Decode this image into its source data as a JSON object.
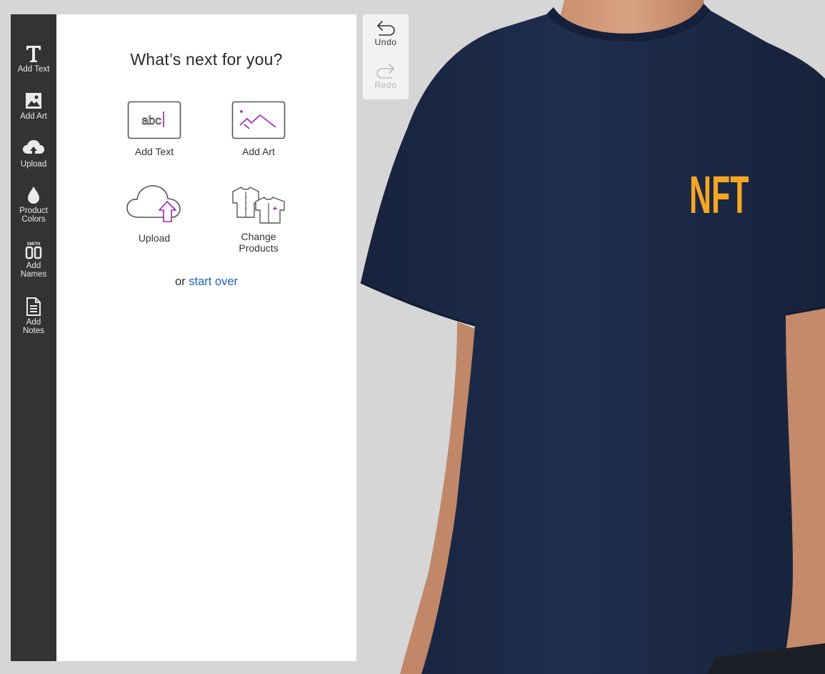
{
  "sidebar": {
    "items": [
      {
        "label": "Add Text",
        "icon": "text-icon"
      },
      {
        "label": "Add Art",
        "icon": "image-icon"
      },
      {
        "label": "Upload",
        "icon": "cloud-upload-icon"
      },
      {
        "label_line1": "Product",
        "label_line2": "Colors",
        "icon": "droplet-icon"
      },
      {
        "label_line1": "Add",
        "label_line2": "Names",
        "icon": "names-icon",
        "icon_text_top": "SMITH",
        "icon_text_bottom": "00"
      },
      {
        "label_line1": "Add",
        "label_line2": "Notes",
        "icon": "notes-icon"
      }
    ]
  },
  "panel": {
    "title": "What’s next for you?",
    "options": [
      {
        "label": "Add Text",
        "icon": "text-box-icon",
        "sample": "abc"
      },
      {
        "label": "Add Art",
        "icon": "art-frame-icon"
      },
      {
        "label": "Upload",
        "icon": "cloud-upload-arrow-icon"
      },
      {
        "label_line1": "Change",
        "label_line2": "Products",
        "icon": "shirts-icon"
      }
    ],
    "start_over_prefix": "or",
    "start_over_link": "start over"
  },
  "history": {
    "undo_label": "Undo",
    "redo_label": "Redo"
  },
  "product": {
    "shirt_color": "#1c2b4a",
    "print_text": "NFT",
    "print_color": "#f5a623"
  },
  "colors": {
    "rail_bg": "#333333",
    "link": "#1f5fc1",
    "accent_purple": "#a020b0"
  }
}
